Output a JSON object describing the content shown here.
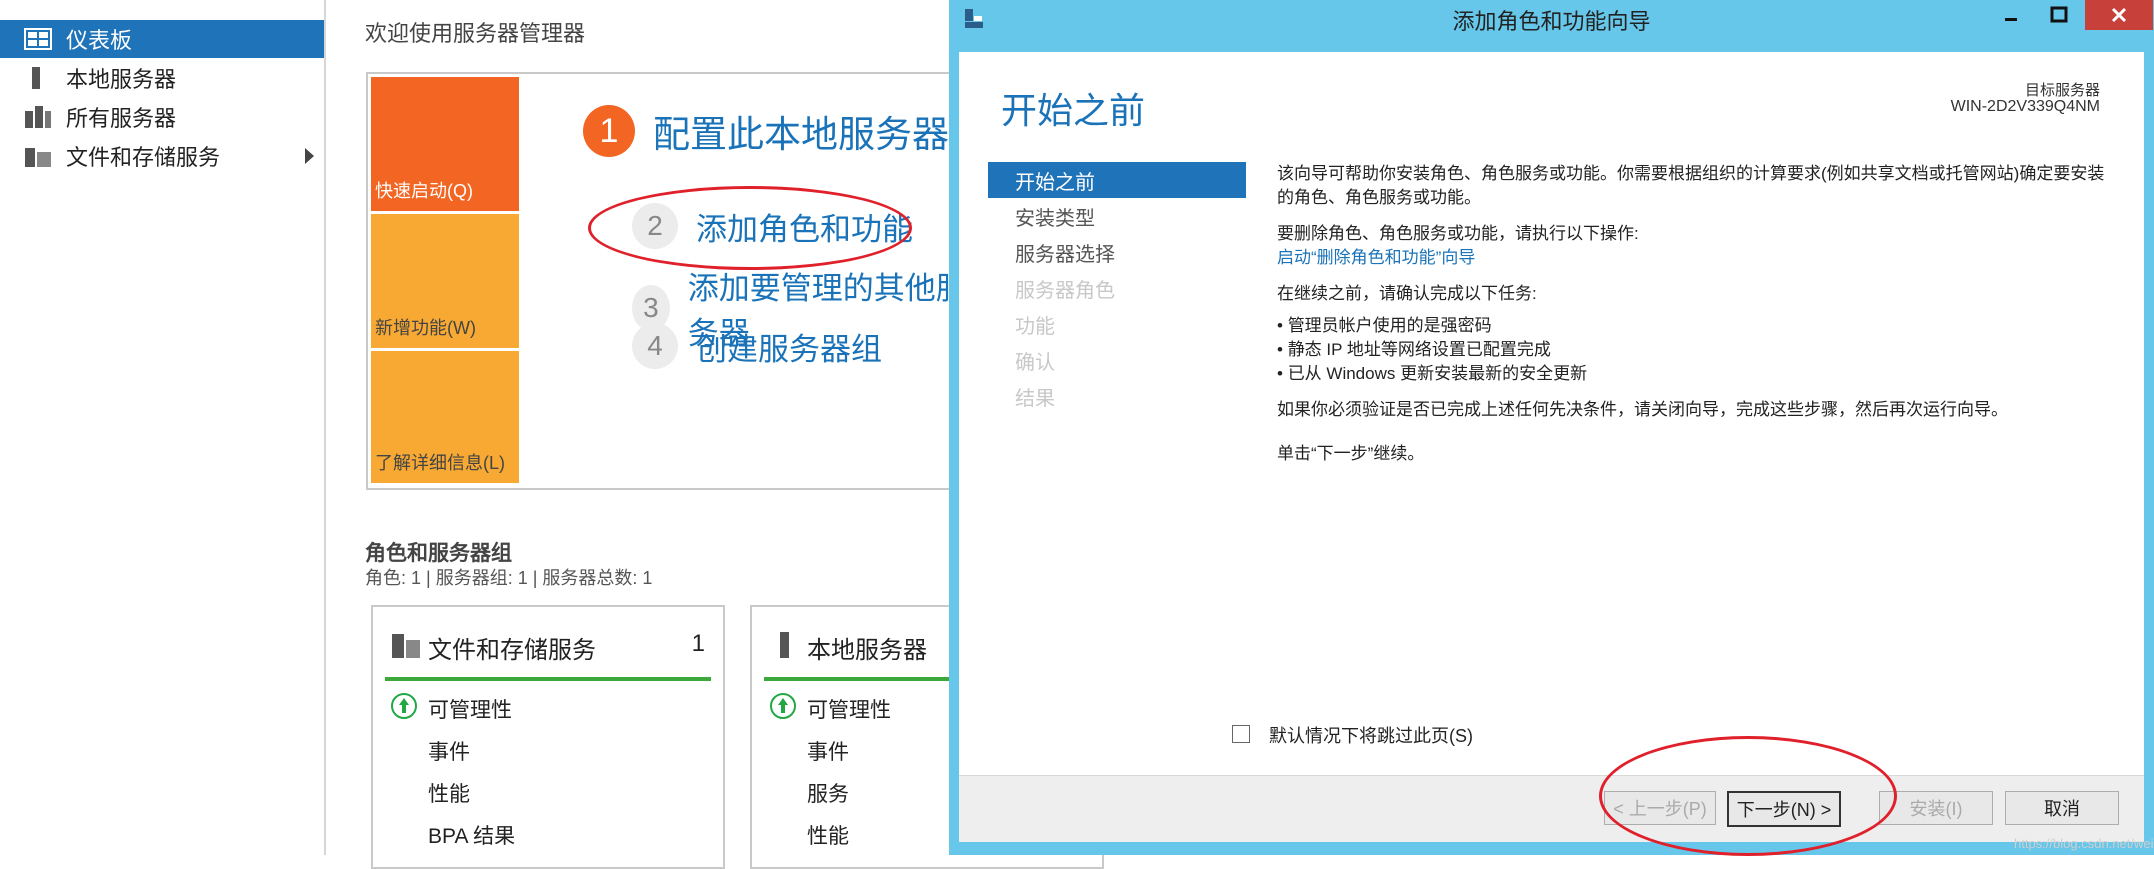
{
  "nav": {
    "items": [
      {
        "label": "仪表板",
        "icon": "dashboard-icon"
      },
      {
        "label": "本地服务器",
        "icon": "server-icon"
      },
      {
        "label": "所有服务器",
        "icon": "servers-icon"
      },
      {
        "label": "文件和存储服务",
        "icon": "storage-icon"
      }
    ]
  },
  "main": {
    "welcome_title": "欢迎使用服务器管理器",
    "tiles": {
      "quick": "快速启动(Q)",
      "new": "新增功能(W)",
      "learn": "了解详细信息(L)"
    },
    "steps": [
      {
        "num": "1",
        "label": "配置此本地服务器"
      },
      {
        "num": "2",
        "label": "添加角色和功能"
      },
      {
        "num": "3",
        "label": "添加要管理的其他服务器"
      },
      {
        "num": "4",
        "label": "创建服务器组"
      }
    ],
    "roles_title": "角色和服务器组",
    "roles_summary": "角色: 1 | 服务器组: 1 | 服务器总数: 1",
    "cards": [
      {
        "title": "文件和存储服务",
        "count": "1",
        "rows": [
          "可管理性",
          "事件",
          "性能",
          "BPA 结果"
        ]
      },
      {
        "title": "本地服务器",
        "count": "",
        "rows": [
          "可管理性",
          "事件",
          "服务",
          "性能"
        ]
      }
    ]
  },
  "dialog": {
    "title": "添加角色和功能向导",
    "heading": "开始之前",
    "target_label": "目标服务器",
    "target_name": "WIN-2D2V339Q4NM",
    "steps": [
      "开始之前",
      "安装类型",
      "服务器选择",
      "服务器角色",
      "功能",
      "确认",
      "结果"
    ],
    "content": {
      "p1": "该向导可帮助你安装角色、角色服务或功能。你需要根据组织的计算要求(例如共享文档或托管网站)确定要安装的角色、角色服务或功能。",
      "p2": "要删除角色、角色服务或功能，请执行以下操作:",
      "link": "启动“删除角色和功能”向导",
      "p3": "在继续之前，请确认完成以下任务:",
      "bullets": [
        "管理员帐户使用的是强密码",
        "静态 IP 地址等网络设置已配置完成",
        "已从 Windows 更新安装最新的安全更新"
      ],
      "p4": "如果你必须验证是否已完成上述任何先决条件，请关闭向导，完成这些步骤，然后再次运行向导。",
      "p5": "单击“下一步”继续。"
    },
    "skip_label": "默认情况下将跳过此页(S)",
    "buttons": {
      "prev": "< 上一步(P)",
      "next": "下一步(N) >",
      "install": "安装(I)",
      "cancel": "取消"
    },
    "watermark": "https://blog.csdn.net/weixin_43660389"
  },
  "colors": {
    "accent": "#1f73b8",
    "title_bar": "#66c7ea",
    "orange": "#f26522",
    "amber": "#f7a934",
    "annotation": "#e0202a"
  }
}
